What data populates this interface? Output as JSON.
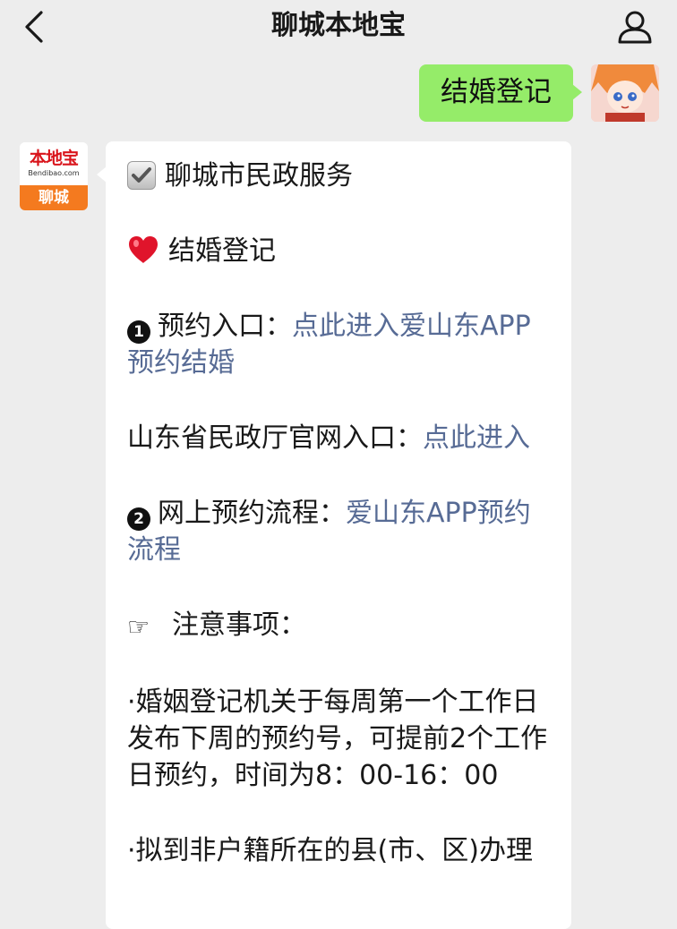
{
  "header": {
    "title": "聊城本地宝"
  },
  "sent_message": {
    "text": "结婚登记"
  },
  "received_message": {
    "sender_logo": {
      "main": "本地宝",
      "sub": "Bendibao.com",
      "city": "聊城"
    },
    "lines": {
      "section_title": "聊城市民政服务",
      "topic": "结婚登记",
      "item1_number": "1",
      "item1_label": "预约入口：",
      "item1_link": "点此进入爱山东APP预约结婚",
      "official_label": "山东省民政厅官网入口：",
      "official_link": "点此进入",
      "item2_number": "2",
      "item2_label": "网上预约流程：",
      "item2_link": "爱山东APP预约流程",
      "notice_icon": "☞",
      "notice_label": "注意事项：",
      "notice_1": "·婚姻登记机关于每周第一个工作日发布下周的预约号，可提前2个工作日预约，时间为8：00-16：00",
      "notice_2": "·拟到非户籍所在的县(市、区)办理"
    }
  },
  "colors": {
    "background": "#ededed",
    "sent_bubble": "#95ec69",
    "link": "#576b95",
    "logo_orange": "#f47a1f"
  },
  "icons": [
    "back-arrow-icon",
    "profile-icon",
    "checkbox-icon",
    "heart-icon",
    "number-one-icon",
    "number-two-icon",
    "pointing-hand-icon"
  ]
}
